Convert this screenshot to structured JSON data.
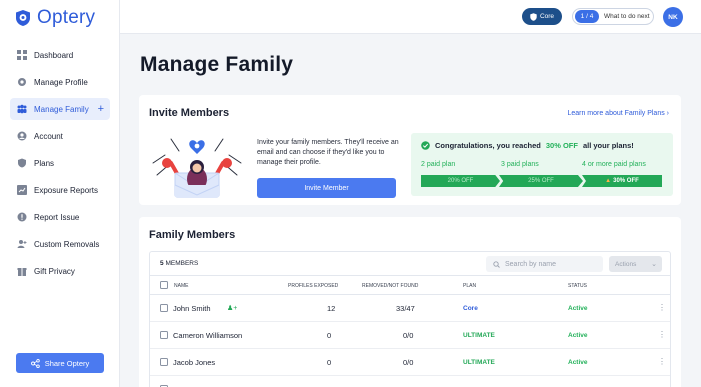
{
  "brand": {
    "name": "Optery"
  },
  "sidebar": {
    "items": [
      {
        "label": "Dashboard",
        "icon": "dashboard-icon"
      },
      {
        "label": "Manage Profile",
        "icon": "gear-icon"
      },
      {
        "label": "Manage Family",
        "icon": "family-icon",
        "active": true
      },
      {
        "label": "Account",
        "icon": "user-icon"
      },
      {
        "label": "Plans",
        "icon": "shield-icon"
      },
      {
        "label": "Exposure Reports",
        "icon": "chart-icon"
      },
      {
        "label": "Report Issue",
        "icon": "alert-icon"
      },
      {
        "label": "Custom Removals",
        "icon": "user-add-icon"
      },
      {
        "label": "Gift Privacy",
        "icon": "gift-icon"
      }
    ],
    "share_label": "Share Optery"
  },
  "topbar": {
    "plan_label": "Core",
    "progress": "1 / 4",
    "next_label": "What to do next",
    "avatar_initials": "NK"
  },
  "page": {
    "title": "Manage Family"
  },
  "invite": {
    "title": "Invite Members",
    "learn_more": "Learn more about Family Plans",
    "description": "Invite your family members. They'll receive an email and can choose if they'd like you to manage their profile.",
    "button_label": "Invite Member",
    "promo": {
      "prefix": "Congratulations, you reached",
      "highlight": "30% OFF",
      "suffix": "all your plans!",
      "tiers": [
        {
          "label": "2 paid plan",
          "discount": "20% OFF"
        },
        {
          "label": "3 paid plans",
          "discount": "25% OFF"
        },
        {
          "label": "4 or more paid plans",
          "discount": "30% OFF",
          "current": true
        }
      ]
    }
  },
  "members": {
    "title": "Family Members",
    "count": "5",
    "count_suffix": "MEMBERS",
    "search_placeholder": "Search by name",
    "actions_label": "Actions",
    "columns": [
      "NAME",
      "PROFILES EXPOSED",
      "REMOVED/NOT FOUND",
      "PLAN",
      "STATUS"
    ],
    "rows": [
      {
        "name": "John Smith",
        "exposed": "12",
        "removed": "33/47",
        "plan": "Core",
        "status": "Active",
        "owner": true
      },
      {
        "name": "Cameron Williamson",
        "exposed": "0",
        "removed": "0/0",
        "plan": "ULTIMATE",
        "status": "Active"
      },
      {
        "name": "Jacob Jones",
        "exposed": "0",
        "removed": "0/0",
        "plan": "ULTIMATE",
        "status": "Active"
      }
    ]
  }
}
